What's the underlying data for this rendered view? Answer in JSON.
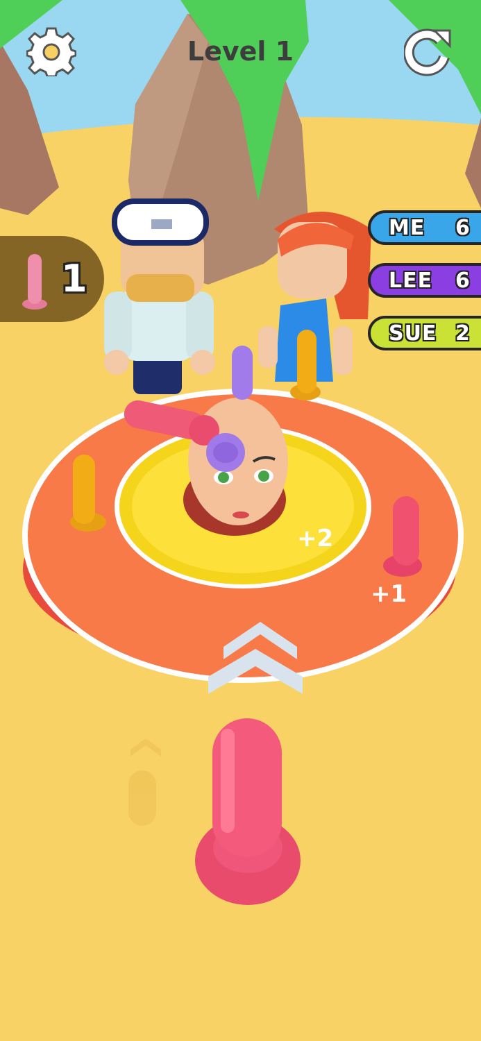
{
  "header": {
    "level": "Level 1"
  },
  "icons": {
    "settings": "gear-icon",
    "restart": "restart-icon",
    "peg": "peg-icon",
    "chevrons": "chevron-up-icon"
  },
  "scoreboard": [
    {
      "name": "ME",
      "score": "6",
      "color": "#3aa6ea"
    },
    {
      "name": "LEE",
      "score": "6",
      "color": "#8b3fe3"
    },
    {
      "name": "SUE",
      "score": "2",
      "color": "#c9e235"
    }
  ],
  "pegs_remaining": "1",
  "ring_labels": {
    "inner": "+2",
    "outer": "+1"
  }
}
